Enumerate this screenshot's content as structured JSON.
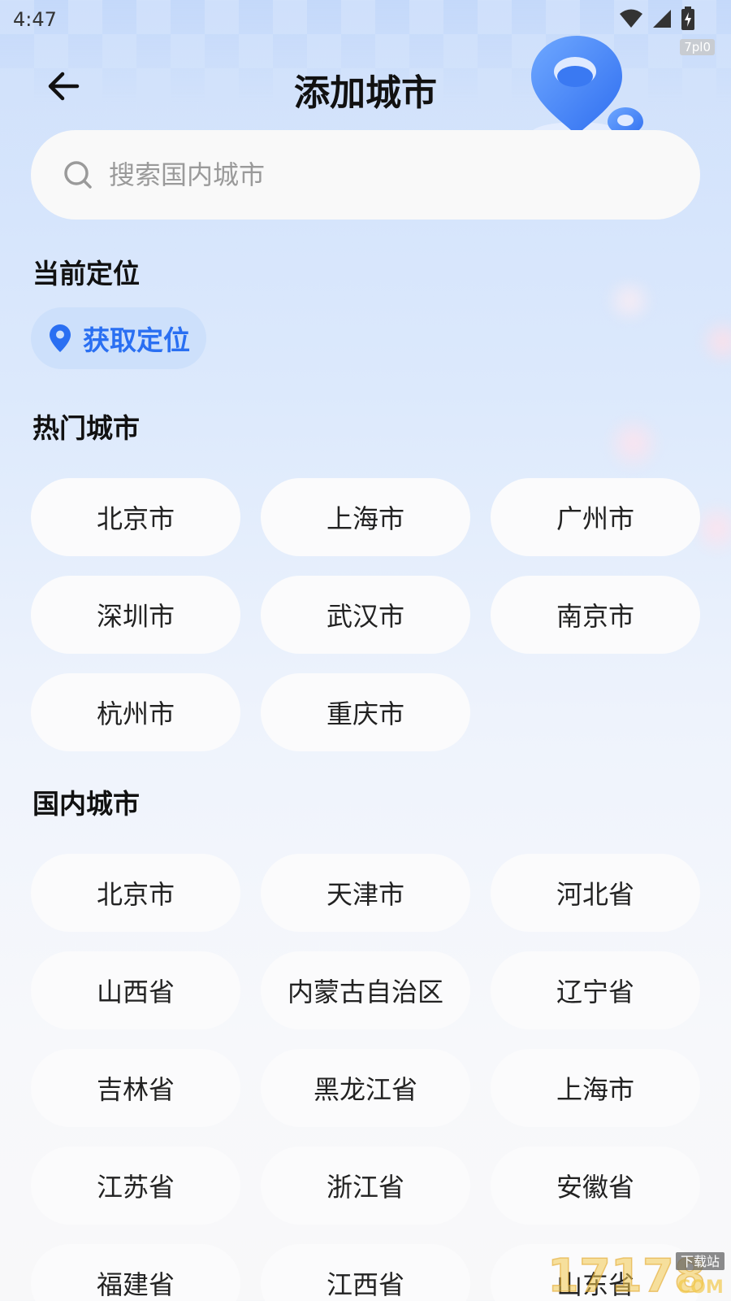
{
  "status_bar": {
    "time": "4:47"
  },
  "watermark_top": "7pl0",
  "header": {
    "title": "添加城市"
  },
  "search": {
    "placeholder": "搜索国内城市"
  },
  "current_location": {
    "section_title": "当前定位",
    "button_label": "获取定位"
  },
  "hot_cities": {
    "section_title": "热门城市",
    "items": [
      "北京市",
      "上海市",
      "广州市",
      "深圳市",
      "武汉市",
      "南京市",
      "杭州市",
      "重庆市"
    ]
  },
  "domestic_cities": {
    "section_title": "国内城市",
    "items": [
      "北京市",
      "天津市",
      "河北省",
      "山西省",
      "内蒙古自治区",
      "辽宁省",
      "吉林省",
      "黑龙江省",
      "上海市",
      "江苏省",
      "浙江省",
      "安徽省",
      "福建省",
      "江西省",
      "山东省"
    ]
  },
  "watermark_bottom": {
    "number": "17178",
    "site": "下载站",
    "com": "COM"
  },
  "colors": {
    "accent": "#2a6ff2",
    "location_button_bg": "#cde0fb",
    "chip_bg": "#fbfbfc"
  }
}
